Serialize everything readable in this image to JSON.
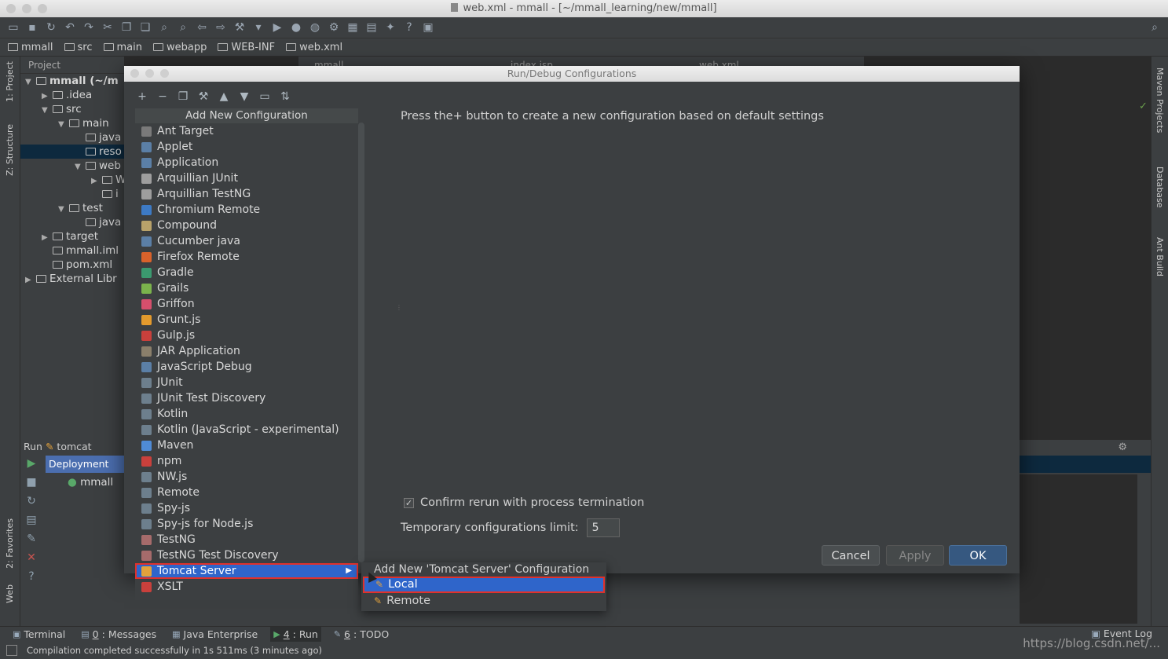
{
  "window": {
    "title": "web.xml - mmall - [~/mmall_learning/new/mmall]"
  },
  "breadcrumb": [
    "mmall",
    "src",
    "main",
    "webapp",
    "WEB-INF",
    "web.xml"
  ],
  "left_tabs": {
    "project": "1: Project",
    "structure": "Z: Structure",
    "favorites": "2: Favorites",
    "web": "Web"
  },
  "right_tabs": {
    "maven": "Maven Projects",
    "database": "Database",
    "ant": "Ant Build"
  },
  "project_panel": {
    "header": "Project",
    "tree": [
      {
        "label": "mmall (~/m",
        "indent": 0,
        "twisty": "▼",
        "bold": true
      },
      {
        "label": ".idea",
        "indent": 1,
        "twisty": "▶"
      },
      {
        "label": "src",
        "indent": 1,
        "twisty": "▼"
      },
      {
        "label": "main",
        "indent": 2,
        "twisty": "▼"
      },
      {
        "label": "java",
        "indent": 3,
        "twisty": ""
      },
      {
        "label": "reso",
        "indent": 3,
        "twisty": "",
        "selected": true
      },
      {
        "label": "web",
        "indent": 3,
        "twisty": "▼"
      },
      {
        "label": "W",
        "indent": 4,
        "twisty": "▶"
      },
      {
        "label": "i",
        "indent": 4,
        "twisty": ""
      },
      {
        "label": "test",
        "indent": 2,
        "twisty": "▼"
      },
      {
        "label": "java",
        "indent": 3,
        "twisty": ""
      },
      {
        "label": "target",
        "indent": 1,
        "twisty": "▶"
      },
      {
        "label": "mmall.iml",
        "indent": 1,
        "twisty": ""
      },
      {
        "label": "pom.xml",
        "indent": 1,
        "twisty": ""
      },
      {
        "label": "External Libr",
        "indent": 0,
        "twisty": "▶"
      }
    ]
  },
  "editor_tabs": [
    "mmall",
    "index.jsp",
    "web.xml"
  ],
  "run_panel": {
    "label": "Run",
    "config": "tomcat",
    "deployment_header": "Deployment",
    "deployment_item": "mmall"
  },
  "dialog": {
    "title": "Run/Debug Configurations",
    "list_header": "Add New Configuration",
    "items": [
      {
        "label": "Ant Target",
        "color": "#7a7a7a"
      },
      {
        "label": "Applet",
        "color": "#5b7fa6"
      },
      {
        "label": "Application",
        "color": "#5b7fa6"
      },
      {
        "label": "Arquillian JUnit",
        "color": "#9e9e9e"
      },
      {
        "label": "Arquillian TestNG",
        "color": "#9e9e9e"
      },
      {
        "label": "Chromium Remote",
        "color": "#3d7ac4"
      },
      {
        "label": "Compound",
        "color": "#b8a26a"
      },
      {
        "label": "Cucumber java",
        "color": "#5b7fa6"
      },
      {
        "label": "Firefox Remote",
        "color": "#d9622b"
      },
      {
        "label": "Gradle",
        "color": "#3b9a6f"
      },
      {
        "label": "Grails",
        "color": "#7bb34c"
      },
      {
        "label": "Griffon",
        "color": "#d64f6c"
      },
      {
        "label": "Grunt.js",
        "color": "#e39a2d"
      },
      {
        "label": "Gulp.js",
        "color": "#c9403c"
      },
      {
        "label": "JAR Application",
        "color": "#8a7f6b"
      },
      {
        "label": "JavaScript Debug",
        "color": "#5b7fa6"
      },
      {
        "label": "JUnit",
        "color": "#6d7f8d"
      },
      {
        "label": "JUnit Test Discovery",
        "color": "#6d7f8d"
      },
      {
        "label": "Kotlin",
        "color": "#6d7f8d"
      },
      {
        "label": "Kotlin (JavaScript - experimental)",
        "color": "#6d7f8d"
      },
      {
        "label": "Maven",
        "color": "#4f8bd6"
      },
      {
        "label": "npm",
        "color": "#c9403c"
      },
      {
        "label": "NW.js",
        "color": "#6d7f8d"
      },
      {
        "label": "Remote",
        "color": "#6d7f8d"
      },
      {
        "label": "Spy-js",
        "color": "#6d7f8d"
      },
      {
        "label": "Spy-js for Node.js",
        "color": "#6d7f8d"
      },
      {
        "label": "TestNG",
        "color": "#a66b6b"
      },
      {
        "label": "TestNG Test Discovery",
        "color": "#a66b6b"
      },
      {
        "label": "Tomcat Server",
        "color": "#e3a23c",
        "highlighted": true,
        "submenu": true
      },
      {
        "label": "XSLT",
        "color": "#c9403c"
      }
    ],
    "hint": "Press the+ button to create a new configuration based on default settings",
    "confirm_label": "Confirm rerun with process termination",
    "confirm_checked": true,
    "limit_label": "Temporary configurations limit:",
    "limit_value": "5",
    "buttons": {
      "cancel": "Cancel",
      "apply": "Apply",
      "ok": "OK"
    }
  },
  "submenu": {
    "header": "Add New 'Tomcat Server' Configuration",
    "items": [
      {
        "label": "Local",
        "highlighted": true
      },
      {
        "label": "Remote",
        "highlighted": false
      }
    ]
  },
  "bottom_tabs": [
    {
      "label": "Terminal",
      "num": ""
    },
    {
      "label": "Messages",
      "num": "0"
    },
    {
      "label": "Java Enterprise",
      "num": ""
    },
    {
      "label": "Run",
      "num": "4",
      "active": true
    },
    {
      "label": "TODO",
      "num": "6"
    }
  ],
  "event_log": "Event Log",
  "status": "Compilation completed successfully in 1s 511ms (3 minutes ago)",
  "watermark": "https://blog.csdn.net/..."
}
